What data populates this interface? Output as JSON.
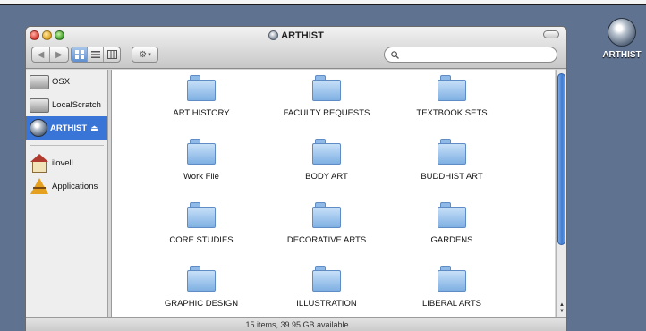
{
  "window": {
    "title": "ARTHIST",
    "status": "15 items, 39.95 GB available"
  },
  "search": {
    "value": ""
  },
  "sidebar": {
    "items": [
      {
        "label": "OSX",
        "icon": "hard-drive-icon"
      },
      {
        "label": "LocalScratch",
        "icon": "hard-drive-icon"
      },
      {
        "label": "ARTHIST",
        "icon": "network-disk-icon",
        "eject": "⏏",
        "selected": true
      }
    ],
    "places": [
      {
        "label": "ilovell",
        "icon": "home-icon"
      },
      {
        "label": "Applications",
        "icon": "applications-icon"
      }
    ]
  },
  "folders": [
    "ART HISTORY",
    "FACULTY REQUESTS",
    "TEXTBOOK SETS",
    "Work File",
    "BODY ART",
    "BUDDHIST ART",
    "CORE STUDIES",
    "DECORATIVE ARTS",
    "GARDENS",
    "GRAPHIC DESIGN",
    "ILLUSTRATION",
    "LIBERAL ARTS"
  ],
  "desktop": {
    "label": "ARTHIST"
  },
  "colors": {
    "desktop": "#5f7290",
    "selection": "#3875d7",
    "folder": "#7fb0e3"
  }
}
